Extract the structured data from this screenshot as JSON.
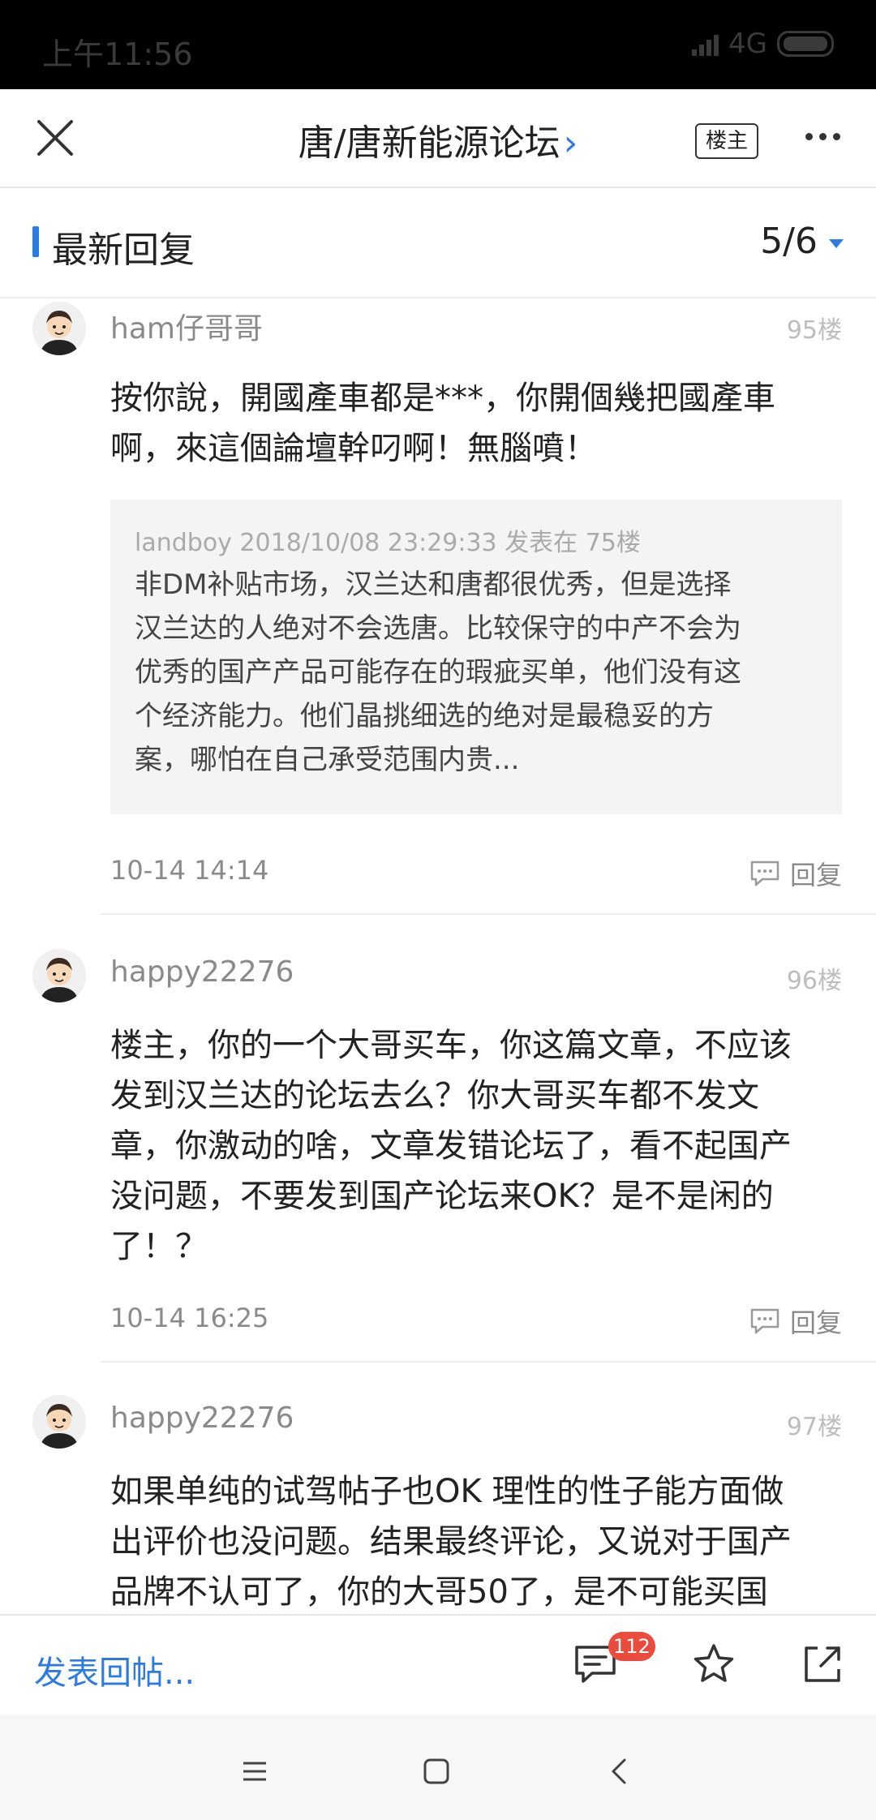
{
  "status_bar": {
    "time": "上午11:56",
    "network": "4G"
  },
  "nav": {
    "title": "唐/唐新能源论坛",
    "chevron": "›",
    "owner_button": "楼主"
  },
  "section": {
    "title": "最新回复",
    "page": "5/6"
  },
  "posts": [
    {
      "username": "ham仔哥哥",
      "floor": "95楼",
      "lines": [
        "按你說，開國產車都是***，你開個幾把國產車",
        "啊，來這個論壇幹叼啊！無腦噴！"
      ],
      "quote": {
        "meta": "landboy 2018/10/08 23:29:33 发表在 75楼",
        "lines": [
          "非DM补贴市场，汉兰达和唐都很优秀，但是选择",
          "汉兰达的人绝对不会选唐。比较保守的中产不会为",
          "优秀的国产产品可能存在的瑕疵买单，他们没有这",
          "个经济能力。他们晶挑细选的绝对是最稳妥的方",
          "案，哪怕在自己承受范围内贵..."
        ]
      },
      "time": "10-14 14:14",
      "reply": "回复"
    },
    {
      "username": "happy22276",
      "floor": "96楼",
      "lines": [
        "楼主，你的一个大哥买车，你这篇文章，不应该",
        "发到汉兰达的论坛去么？你大哥买车都不发文",
        "章，你激动的啥，文章发错论坛了，看不起国产",
        "没问题，不要发到国产论坛来OK？是不是闲的",
        "了！？"
      ],
      "time": "10-14 16:25",
      "reply": "回复"
    },
    {
      "username": "happy22276",
      "floor": "97楼",
      "lines": [
        "如果单纯的试驾帖子也OK 理性的性子能方面做",
        "出评价也没问题。结果最终评论，又说对于国产",
        "品牌不认可了，你的大哥50了，是不可能买国"
      ]
    }
  ],
  "bottom": {
    "compose": "发表回帖...",
    "comment_count": "112"
  },
  "colors": {
    "accent": "#2c7be5",
    "badge": "#e94b3c"
  }
}
